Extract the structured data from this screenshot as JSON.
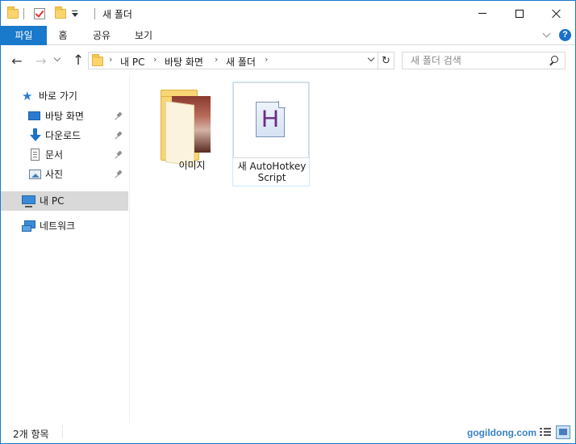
{
  "window": {
    "title": "새 폴더"
  },
  "ribbon": {
    "tabs": [
      {
        "label": "파일"
      },
      {
        "label": "홈"
      },
      {
        "label": "공유"
      },
      {
        "label": "보기"
      }
    ]
  },
  "nav": {
    "breadcrumb": [
      "내 PC",
      "바탕 화면",
      "새 폴더"
    ],
    "search_placeholder": "새 폴더 검색"
  },
  "sidebar": {
    "quick_access": "바로 가기",
    "items": [
      {
        "label": "바탕 화면",
        "icon": "desktop-icon",
        "pinned": true
      },
      {
        "label": "다운로드",
        "icon": "download-icon",
        "pinned": true
      },
      {
        "label": "문서",
        "icon": "documents-icon",
        "pinned": true
      },
      {
        "label": "사진",
        "icon": "pictures-icon",
        "pinned": true
      }
    ],
    "this_pc": "내 PC",
    "network": "네트워크"
  },
  "content": {
    "files": [
      {
        "name": "이미지",
        "type": "folder"
      },
      {
        "name": "새 AutoHotkey Script",
        "type": "ahk-script",
        "icon_letter": "H"
      }
    ]
  },
  "status": {
    "item_count": "2개 항목",
    "watermark": "gogildong.com"
  },
  "colors": {
    "accent": "#1979ca",
    "selection": "#d9d9d9"
  }
}
